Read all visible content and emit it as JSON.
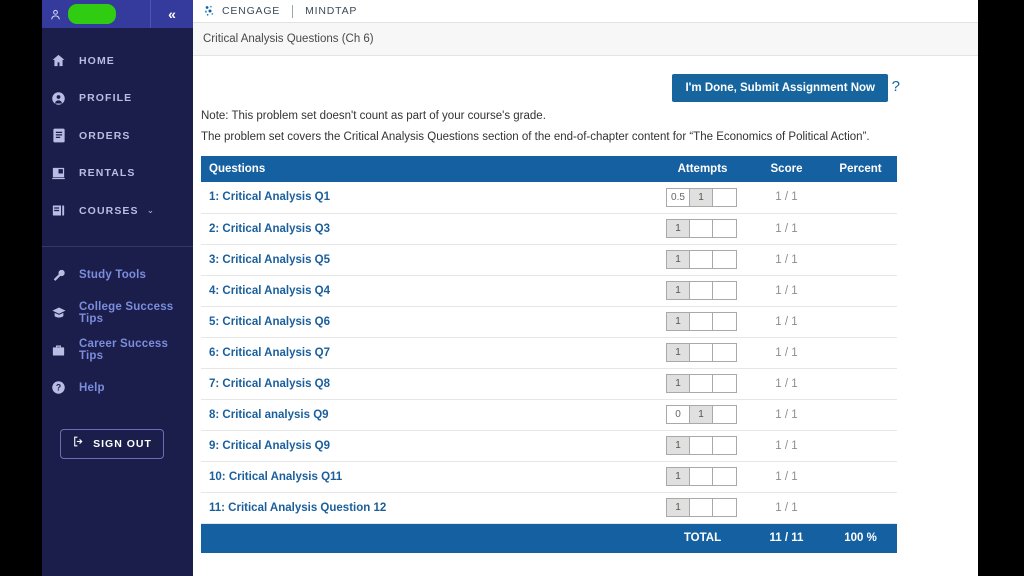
{
  "window": {
    "left_bar_color": "#000000",
    "right_bar_color": "#000000"
  },
  "sidebar": {
    "user": {
      "icon": "user-icon",
      "name_redacted": true,
      "redaction_color": "#2fcc12"
    },
    "collapse_label": "«",
    "primary_items": [
      {
        "icon": "home-icon",
        "label": "HOME"
      },
      {
        "icon": "profile-icon",
        "label": "PROFILE"
      },
      {
        "icon": "orders-icon",
        "label": "ORDERS"
      },
      {
        "icon": "rentals-icon",
        "label": "RENTALS"
      },
      {
        "icon": "courses-icon",
        "label": "COURSES",
        "chevron": "⌄"
      }
    ],
    "secondary_items": [
      {
        "icon": "wrench-icon",
        "label": "Study Tools"
      },
      {
        "icon": "graduation-icon",
        "label": "College Success Tips"
      },
      {
        "icon": "briefcase-icon",
        "label": "Career Success Tips"
      },
      {
        "icon": "help-icon",
        "label": "Help"
      }
    ],
    "sign_out": {
      "icon": "sign-out-icon",
      "label": "SIGN OUT"
    }
  },
  "topbar": {
    "brand": "CENGAGE",
    "product": "MINDTAP",
    "logo_icon": "cengage-logo-icon"
  },
  "breadcrumb": {
    "text": "Critical Analysis Questions (Ch 6)"
  },
  "actions": {
    "submit_label": "I'm Done, Submit Assignment Now",
    "submit_color": "#16659e",
    "help_glyph": "?"
  },
  "notes": {
    "line1": "Note: This problem set doesn't count as part of your course's grade.",
    "line2": "The problem set covers the Critical Analysis Questions section of the end-of-chapter content for “The Economics of Political Action”."
  },
  "table": {
    "header_color": "#1560a0",
    "columns": {
      "questions": "Questions",
      "attempts": "Attempts",
      "score": "Score",
      "percent": "Percent"
    },
    "rows": [
      {
        "question": "1: Critical Analysis Q1",
        "attempts": [
          "0.5",
          "1",
          ""
        ],
        "attempt_filled": [
          false,
          true,
          false
        ],
        "score": "1 / 1",
        "percent": ""
      },
      {
        "question": "2: Critical Analysis Q3",
        "attempts": [
          "1",
          "",
          ""
        ],
        "attempt_filled": [
          true,
          false,
          false
        ],
        "score": "1 / 1",
        "percent": ""
      },
      {
        "question": "3: Critical Analysis Q5",
        "attempts": [
          "1",
          "",
          ""
        ],
        "attempt_filled": [
          true,
          false,
          false
        ],
        "score": "1 / 1",
        "percent": ""
      },
      {
        "question": "4: Critical Analysis Q4",
        "attempts": [
          "1",
          "",
          ""
        ],
        "attempt_filled": [
          true,
          false,
          false
        ],
        "score": "1 / 1",
        "percent": ""
      },
      {
        "question": "5: Critical Analysis Q6",
        "attempts": [
          "1",
          "",
          ""
        ],
        "attempt_filled": [
          true,
          false,
          false
        ],
        "score": "1 / 1",
        "percent": ""
      },
      {
        "question": "6: Critical Analysis Q7",
        "attempts": [
          "1",
          "",
          ""
        ],
        "attempt_filled": [
          true,
          false,
          false
        ],
        "score": "1 / 1",
        "percent": ""
      },
      {
        "question": "7: Critical Analysis Q8",
        "attempts": [
          "1",
          "",
          ""
        ],
        "attempt_filled": [
          true,
          false,
          false
        ],
        "score": "1 / 1",
        "percent": ""
      },
      {
        "question": "8: Critical analysis Q9",
        "attempts": [
          "0",
          "1",
          ""
        ],
        "attempt_filled": [
          false,
          true,
          false
        ],
        "score": "1 / 1",
        "percent": ""
      },
      {
        "question": "9: Critical Analysis Q9",
        "attempts": [
          "1",
          "",
          ""
        ],
        "attempt_filled": [
          true,
          false,
          false
        ],
        "score": "1 / 1",
        "percent": ""
      },
      {
        "question": "10: Critical Analysis Q11",
        "attempts": [
          "1",
          "",
          ""
        ],
        "attempt_filled": [
          true,
          false,
          false
        ],
        "score": "1 / 1",
        "percent": ""
      },
      {
        "question": "11: Critical Analysis Question 12",
        "attempts": [
          "1",
          "",
          ""
        ],
        "attempt_filled": [
          true,
          false,
          false
        ],
        "score": "1 / 1",
        "percent": ""
      }
    ],
    "total": {
      "label": "TOTAL",
      "score": "11 / 11",
      "percent": "100 %"
    }
  }
}
